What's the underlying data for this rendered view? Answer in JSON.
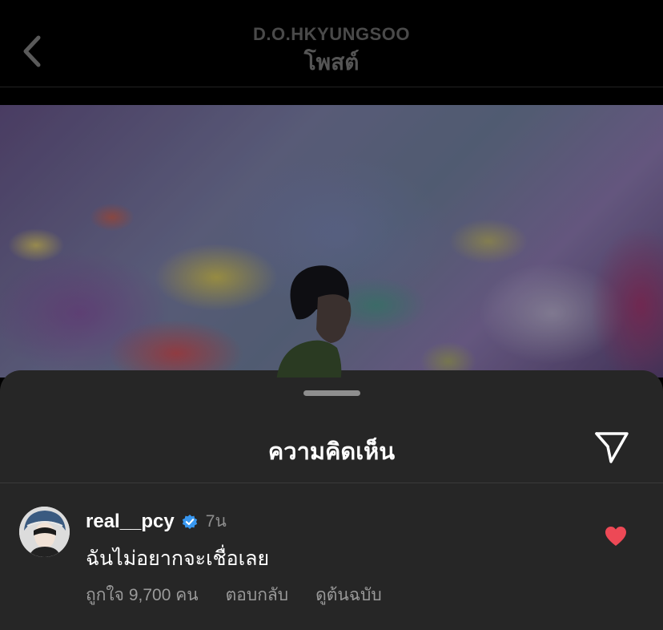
{
  "header": {
    "username": "D.O.HKYUNGSOO",
    "title": "โพสต์",
    "back_icon": "chevron-left-icon"
  },
  "sheet": {
    "title": "ความคิดเห็น",
    "share_icon": "send-icon"
  },
  "comment": {
    "username": "real__pcy",
    "verified": true,
    "time": "7น",
    "text": "ฉันไม่อยากจะเชื่อเลย",
    "likes_label": "ถูกใจ 9,700 คน",
    "reply_label": "ตอบกลับ",
    "view_original_label": "ดูต้นฉบับ",
    "liked": true
  },
  "colors": {
    "sheet_bg": "#262626",
    "heart": "#ed4956",
    "verified": "#3897f0",
    "muted_text": "#8e8e8e"
  }
}
